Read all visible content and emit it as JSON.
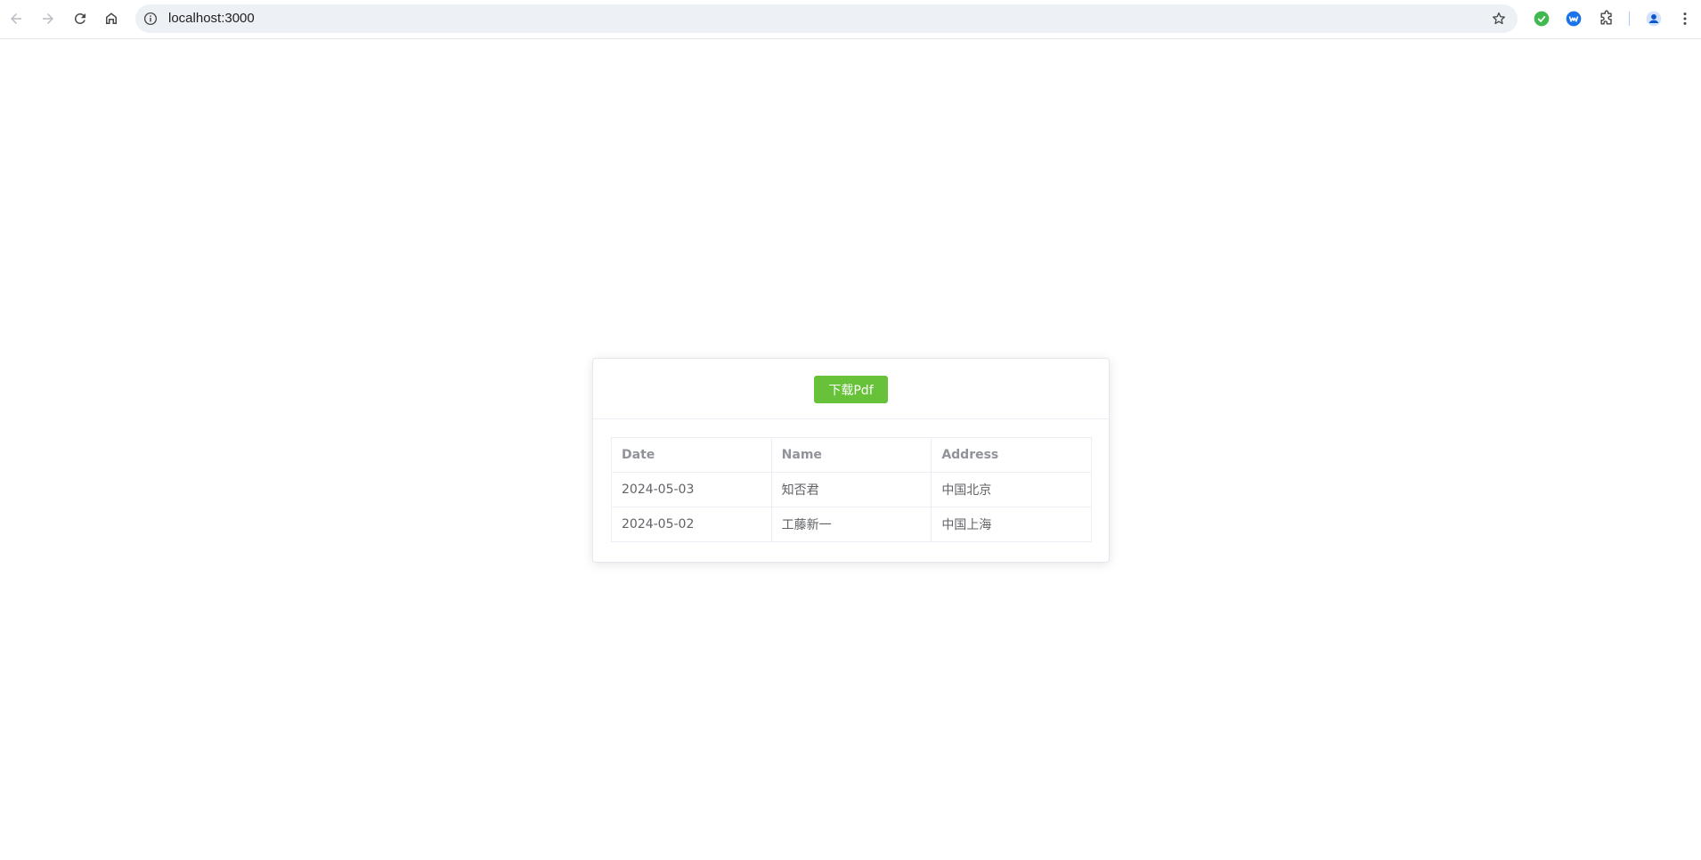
{
  "browser": {
    "url": "localhost:3000"
  },
  "card": {
    "download_label": "下载Pdf",
    "table": {
      "headers": [
        "Date",
        "Name",
        "Address"
      ],
      "rows": [
        [
          "2024-05-03",
          "知否君",
          "中国北京"
        ],
        [
          "2024-05-02",
          "工藤新一",
          "中国上海"
        ]
      ]
    }
  },
  "colors": {
    "button_bg": "#67c23a",
    "omnibox_bg": "#edf1f5"
  }
}
